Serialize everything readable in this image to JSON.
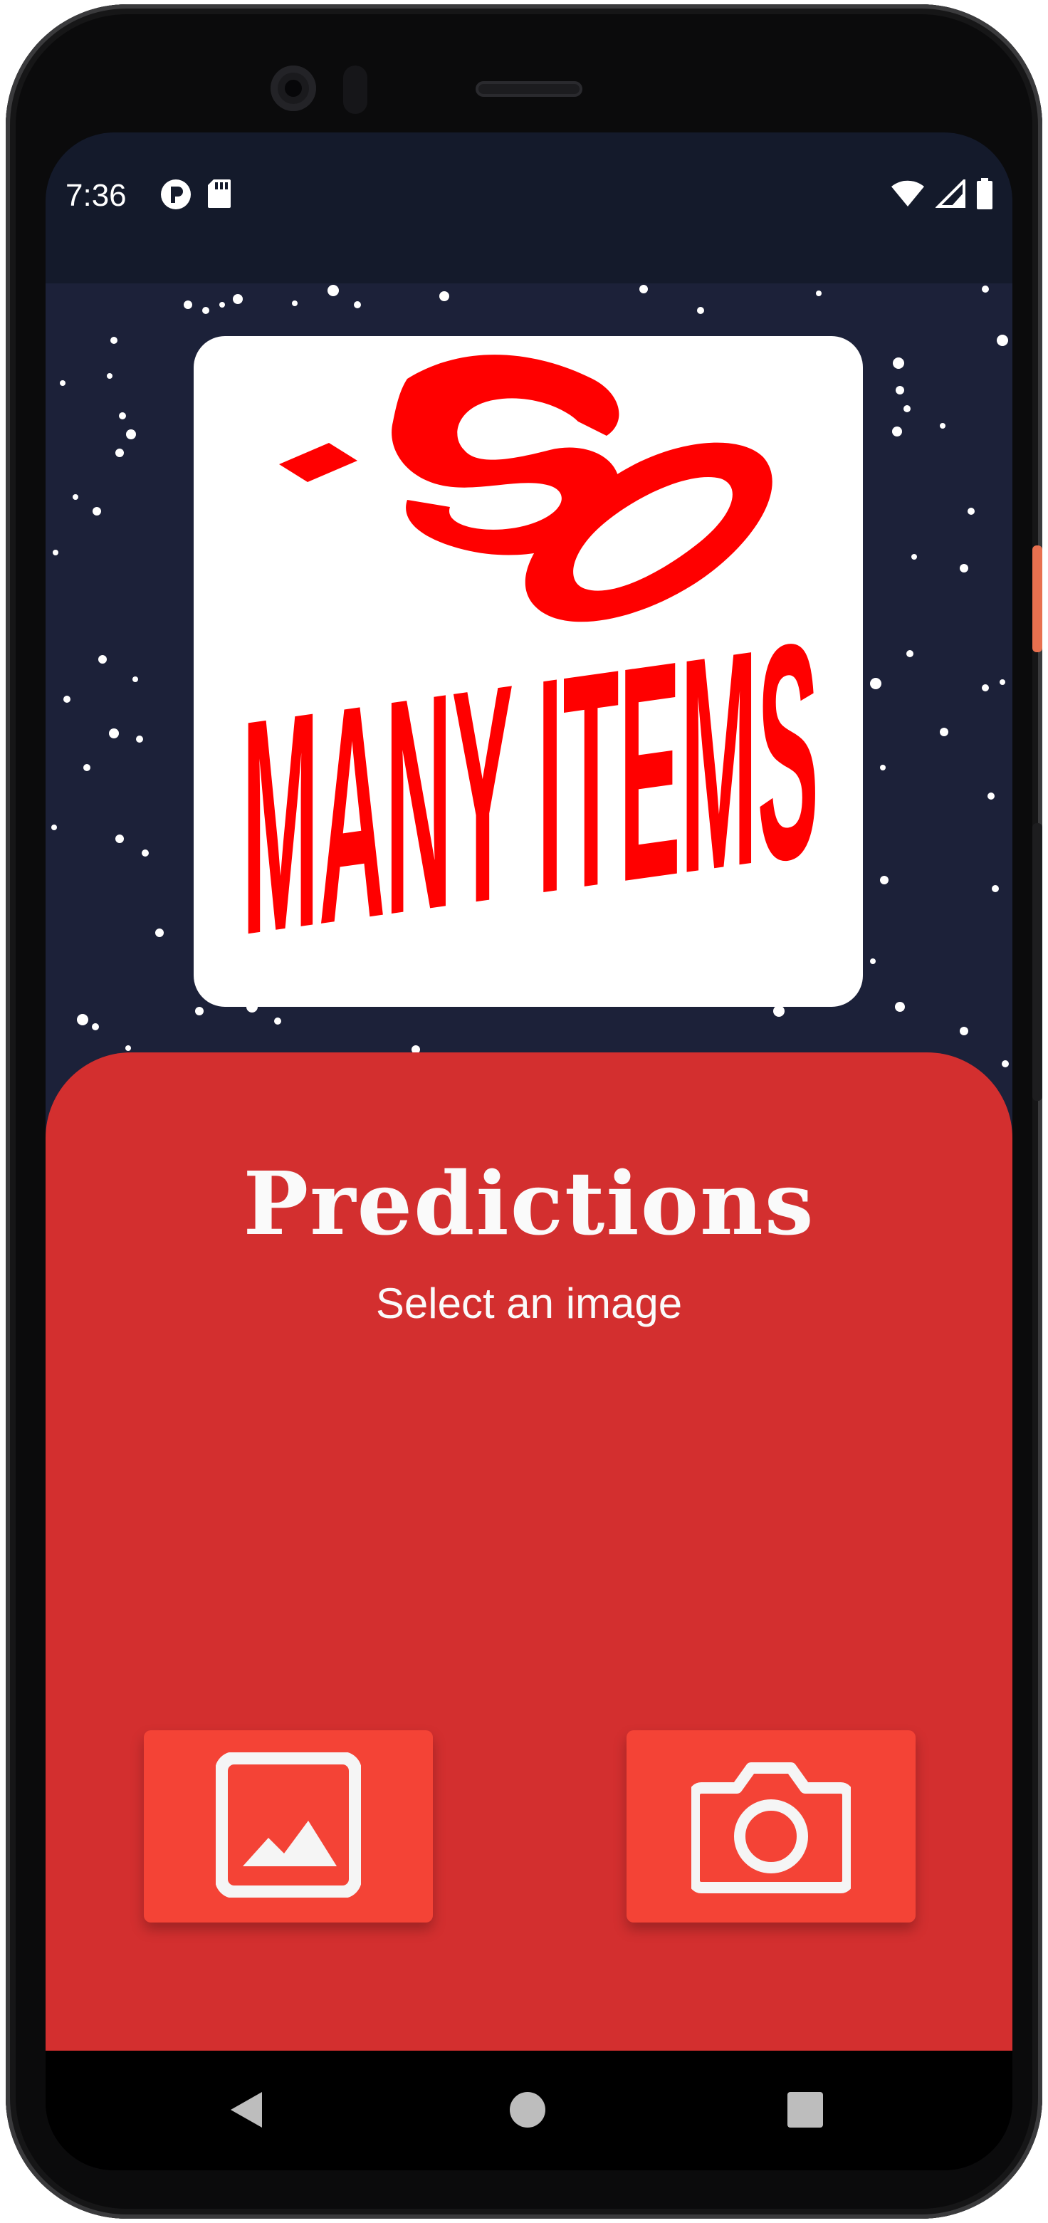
{
  "status_bar": {
    "time": "7:36",
    "left_icons": [
      "notification-p-icon",
      "sd-card-icon"
    ],
    "right_icons": [
      "wifi-icon",
      "signal-icon",
      "battery-icon"
    ]
  },
  "logo": {
    "alt_text": "SO MANY ITEMS",
    "word_top": "SO",
    "word_bottom": "MANY ITEMS",
    "color": "#ff0000"
  },
  "predictions": {
    "title": "Predictions",
    "subtitle": "Select an image"
  },
  "buttons": {
    "gallery_icon": "image-icon",
    "camera_icon": "camera-icon"
  },
  "colors": {
    "status_bar": "#141a2b",
    "background": "#1c2139",
    "panel": "#d32f2f",
    "button": "#f44336",
    "text": "#fafafa"
  },
  "nav_bar": {
    "icons": [
      "back-icon",
      "home-icon",
      "recents-icon"
    ]
  }
}
